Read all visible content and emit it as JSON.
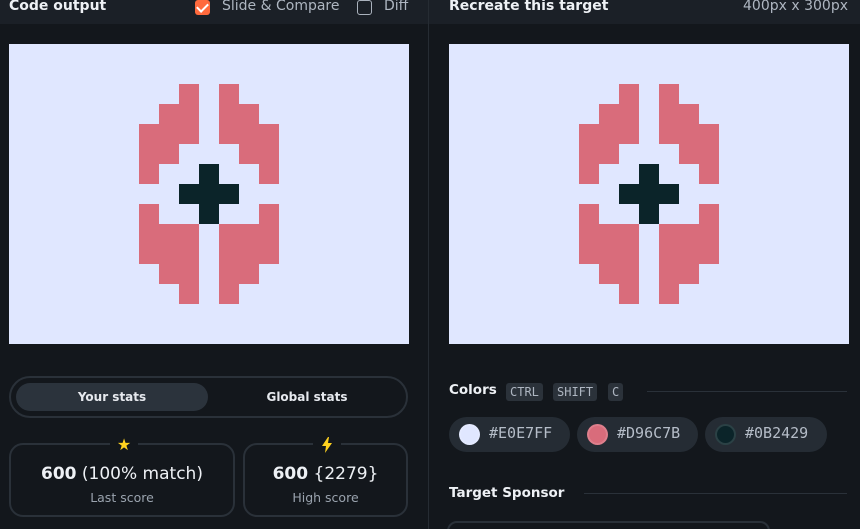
{
  "left": {
    "title": "Code output",
    "slide_compare": {
      "label": "Slide & Compare",
      "checked": true
    },
    "diff": {
      "label": "Diff",
      "checked": false
    },
    "stats_tabs": [
      "Your stats",
      "Global stats"
    ],
    "last_score": {
      "value": "600",
      "detail": "(100% match)",
      "label": "Last score",
      "icon": "star-icon"
    },
    "high_score": {
      "value": "600",
      "detail": "{2279}",
      "label": "High score",
      "icon": "bolt-icon"
    }
  },
  "right": {
    "title": "Recreate this target",
    "dimensions": "400px x 300px",
    "colors_title": "Colors",
    "shortcut_keys": [
      "CTRL",
      "SHIFT",
      "C"
    ],
    "colors": [
      {
        "hex": "#E0E7FF"
      },
      {
        "hex": "#D96C7B"
      },
      {
        "hex": "#0B2429"
      }
    ],
    "sponsor_title": "Target Sponsor"
  },
  "palette": {
    "accent": "#ff6a3d",
    "star": "#ffd21f",
    "bolt": "#ffd21f"
  }
}
